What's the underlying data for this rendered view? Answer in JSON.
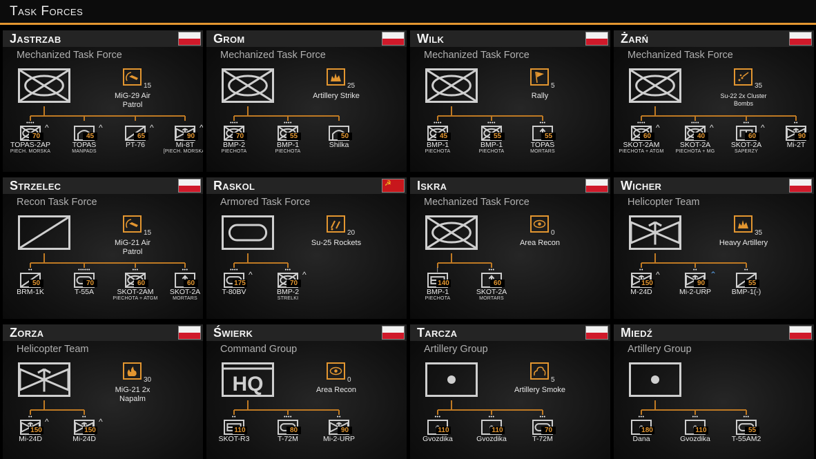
{
  "header": {
    "title": "Task Forces"
  },
  "task_forces": [
    {
      "name": "Jastrzab",
      "type": "Mechanized Task Force",
      "flag": "pl",
      "symbol": "mech",
      "support": {
        "icon": "air-patrol",
        "count": "15",
        "name": "MiG-29 Air Patrol"
      },
      "units": [
        {
          "dots": "••••",
          "symbol": "mech",
          "count": "70",
          "caret": "^",
          "name": "TOPAS-2AP",
          "sub": "Piech. morska"
        },
        {
          "dots": "",
          "symbol": "aa",
          "count": "45",
          "caret": "^",
          "name": "TOPAS",
          "sub": "MANPADS"
        },
        {
          "dots": "",
          "symbol": "recon",
          "count": "65",
          "caret": "^",
          "name": "PT-76",
          "sub": ""
        },
        {
          "dots": "",
          "symbol": "heli",
          "count": "90",
          "caret": "^",
          "name": "Mi-8T",
          "sub": "[Piech. morska]"
        }
      ]
    },
    {
      "name": "Grom",
      "type": "Mechanized Task Force",
      "flag": "pl",
      "symbol": "mech",
      "support": {
        "icon": "artillery",
        "count": "25",
        "name": "Artillery Strike"
      },
      "units": [
        {
          "dots": "••••",
          "symbol": "mech",
          "count": "70",
          "caret": "",
          "name": "BMP-2",
          "sub": "Piechota"
        },
        {
          "dots": "••••",
          "symbol": "mech",
          "count": "55",
          "caret": "",
          "name": "BMP-1",
          "sub": "Piechota"
        },
        {
          "dots": "",
          "symbol": "aa",
          "count": "50",
          "caret": "",
          "name": "Shilka",
          "sub": ""
        }
      ]
    },
    {
      "name": "Wilk",
      "type": "Mechanized Task Force",
      "flag": "pl",
      "symbol": "mech",
      "support": {
        "icon": "rally",
        "count": "5",
        "name": "Rally"
      },
      "units": [
        {
          "dots": "••••",
          "symbol": "mech",
          "count": "45",
          "caret": "",
          "name": "BMP-1",
          "sub": "Piechota"
        },
        {
          "dots": "••••",
          "symbol": "mech",
          "count": "55",
          "caret": "",
          "name": "BMP-1",
          "sub": "Piechota"
        },
        {
          "dots": "•••",
          "symbol": "mortar",
          "count": "55",
          "caret": "",
          "name": "TOPAS",
          "sub": "Mortars"
        }
      ]
    },
    {
      "name": "Żarń",
      "type": "Mechanized Task Force",
      "flag": "pl",
      "symbol": "mech",
      "support": {
        "icon": "cluster",
        "count": "35",
        "name": "Su-22 2x Cluster Bombs"
      },
      "units": [
        {
          "dots": "••••",
          "symbol": "mech",
          "count": "60",
          "caret": "^",
          "name": "SKOT-2AM",
          "sub": "Piechota + ATGM"
        },
        {
          "dots": "••••",
          "symbol": "mech",
          "count": "40",
          "caret": "^",
          "name": "SKOT-2A",
          "sub": "Piechota + MG"
        },
        {
          "dots": "•••",
          "symbol": "engineer",
          "count": "60",
          "caret": "^",
          "name": "SKOT-2A",
          "sub": "Saperzy"
        },
        {
          "dots": "••",
          "symbol": "heli",
          "count": "90",
          "caret": "",
          "name": "Mi-2T",
          "sub": ""
        }
      ]
    },
    {
      "name": "Strzelec",
      "type": "Recon Task Force",
      "flag": "pl",
      "symbol": "recon",
      "support": {
        "icon": "air-patrol",
        "count": "15",
        "name": "MiG-21 Air Patrol"
      },
      "units": [
        {
          "dots": "••",
          "symbol": "recon",
          "count": "50",
          "caret": "",
          "name": "BRM-1K",
          "sub": ""
        },
        {
          "dots": "••••••",
          "symbol": "armor",
          "count": "70",
          "caret": "",
          "name": "T-55A",
          "sub": ""
        },
        {
          "dots": "•••",
          "symbol": "mech",
          "count": "60",
          "caret": "",
          "name": "SKOT-2AM",
          "sub": "Piechota + ATGM"
        },
        {
          "dots": "•••",
          "symbol": "mortar",
          "count": "60",
          "caret": "",
          "name": "SKOT-2A",
          "sub": "Mortars"
        }
      ]
    },
    {
      "name": "Raskol",
      "type": "Armored Task Force",
      "flag": "su",
      "symbol": "armor",
      "support": {
        "icon": "rockets",
        "count": "20",
        "name": "Su-25 Rockets"
      },
      "units": [
        {
          "dots": "••••",
          "symbol": "armor",
          "count": "175",
          "caret": "^",
          "name": "T-80BV",
          "sub": ""
        },
        {
          "dots": "•••",
          "symbol": "mech",
          "count": "70",
          "caret": "^",
          "name": "BMP-2",
          "sub": "Strelki"
        }
      ]
    },
    {
      "name": "Iskra",
      "type": "Mechanized Task Force",
      "flag": "pl",
      "symbol": "mech",
      "support": {
        "icon": "recon",
        "count": "0",
        "name": "Area Recon"
      },
      "units": [
        {
          "dots": "|",
          "symbol": "hq-small",
          "count": "140",
          "caret": "",
          "name": "BMP-1",
          "sub": "Piechota"
        },
        {
          "dots": "•••",
          "symbol": "mortar",
          "count": "60",
          "caret": "",
          "name": "SKOT-2A",
          "sub": "Mortars"
        }
      ]
    },
    {
      "name": "Wicher",
      "type": "Helicopter Team",
      "flag": "pl",
      "symbol": "heli",
      "support": {
        "icon": "artillery",
        "count": "35",
        "name": "Heavy Artillery"
      },
      "units": [
        {
          "dots": "••",
          "symbol": "heli",
          "count": "150",
          "caret": "^",
          "name": "M-24D",
          "sub": ""
        },
        {
          "dots": "••",
          "symbol": "heli",
          "count": "90",
          "caret": "^^",
          "name": "Mi-2-URP",
          "sub": ""
        },
        {
          "dots": "••",
          "symbol": "recon",
          "count": "55",
          "caret": "",
          "name": "BMP-1(-)",
          "sub": ""
        }
      ]
    },
    {
      "name": "Zorza",
      "type": "Helicopter Team",
      "flag": "pl",
      "symbol": "heli",
      "support": {
        "icon": "napalm",
        "count": "30",
        "name": "MiG-21 2x Napalm"
      },
      "units": [
        {
          "dots": "••",
          "symbol": "heli",
          "count": "150",
          "caret": "^",
          "name": "Mi-24D",
          "sub": ""
        },
        {
          "dots": "••",
          "symbol": "heli",
          "count": "150",
          "caret": "^",
          "name": "Mi-24D",
          "sub": ""
        }
      ]
    },
    {
      "name": "Świerk",
      "type": "Command Group",
      "flag": "pl",
      "symbol": "hq",
      "support": {
        "icon": "recon",
        "count": "0",
        "name": "Area Recon"
      },
      "units": [
        {
          "dots": "••",
          "symbol": "hq-small",
          "count": "110",
          "caret": "",
          "name": "SKOT-R3",
          "sub": ""
        },
        {
          "dots": "••••",
          "symbol": "armor",
          "count": "80",
          "caret": "",
          "name": "T-72M",
          "sub": ""
        },
        {
          "dots": "••",
          "symbol": "heli",
          "count": "90",
          "caret": "",
          "name": "Mi-2-URP",
          "sub": ""
        }
      ]
    },
    {
      "name": "Tarcza",
      "type": "Artillery Group",
      "flag": "pl",
      "symbol": "arty",
      "support": {
        "icon": "smoke",
        "count": "5",
        "name": "Artillery Smoke"
      },
      "units": [
        {
          "dots": "•••",
          "symbol": "arty",
          "count": "110",
          "caret": "",
          "name": "Gvozdika",
          "sub": ""
        },
        {
          "dots": "•••",
          "symbol": "arty",
          "count": "110",
          "caret": "",
          "name": "Gvozdika",
          "sub": ""
        },
        {
          "dots": "•••",
          "symbol": "armor",
          "count": "70",
          "caret": "",
          "name": "T-72M",
          "sub": ""
        }
      ]
    },
    {
      "name": "Miedź",
      "type": "Artillery Group",
      "flag": "pl",
      "symbol": "arty",
      "support": {
        "icon": "",
        "count": "",
        "name": ""
      },
      "units": [
        {
          "dots": "•••",
          "symbol": "arty",
          "count": "180",
          "caret": "",
          "name": "Dana",
          "sub": ""
        },
        {
          "dots": "•••",
          "symbol": "arty",
          "count": "110",
          "caret": "",
          "name": "Gvozdika",
          "sub": ""
        },
        {
          "dots": "•••",
          "symbol": "armor",
          "count": "55",
          "caret": "",
          "name": "T-55AM2",
          "sub": ""
        }
      ]
    }
  ],
  "colors": {
    "accent": "#e39630",
    "line": "#c07a23",
    "panel": "#121212",
    "header_bar": "#242424"
  }
}
